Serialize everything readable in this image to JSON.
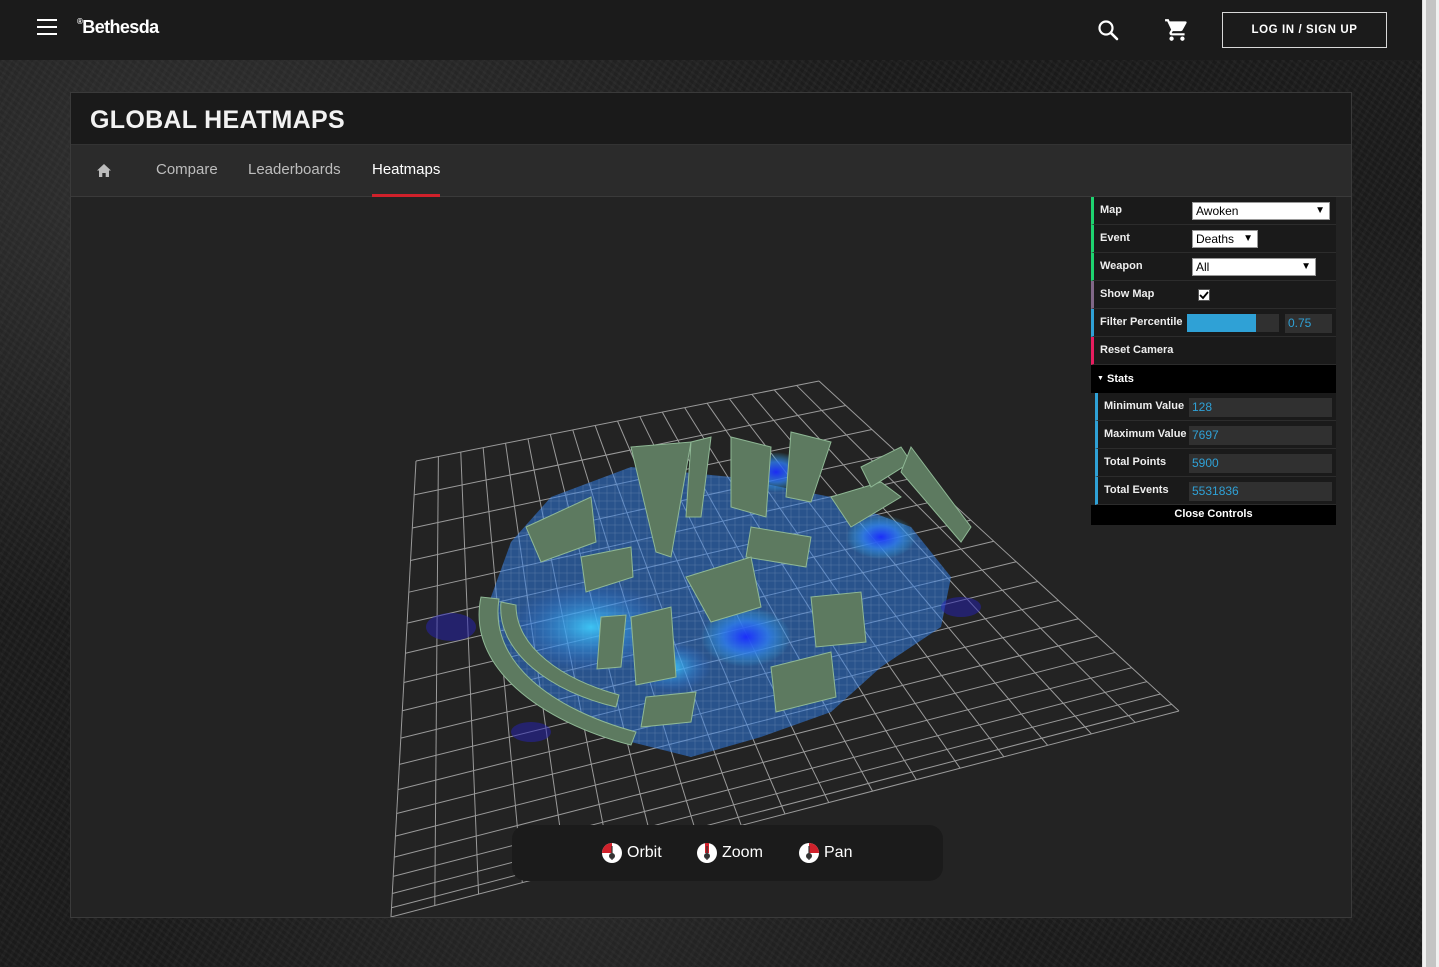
{
  "brand": {
    "logo_text": "Bethesda",
    "logo_mark": "®"
  },
  "header": {
    "login_label": "LOG IN / SIGN UP"
  },
  "page": {
    "title": "GLOBAL HEATMAPS"
  },
  "tabs": [
    {
      "label": "Compare"
    },
    {
      "label": "Leaderboards"
    },
    {
      "label": "Heatmaps",
      "active": true
    }
  ],
  "controls": {
    "map": {
      "label": "Map",
      "value": "Awoken"
    },
    "event": {
      "label": "Event",
      "value": "Deaths"
    },
    "weapon": {
      "label": "Weapon",
      "value": "All"
    },
    "show_map": {
      "label": "Show Map",
      "checked": true
    },
    "filter_percentile": {
      "label": "Filter Percentile",
      "value": "0.75",
      "fraction": 0.75
    },
    "reset_camera": {
      "label": "Reset Camera"
    },
    "stats": {
      "title": "Stats",
      "rows": [
        {
          "label": "Minimum Value",
          "value": "128"
        },
        {
          "label": "Maximum Value",
          "value": "7697"
        },
        {
          "label": "Total Points",
          "value": "5900"
        },
        {
          "label": "Total Events",
          "value": "5531836"
        }
      ]
    },
    "close_label": "Close Controls"
  },
  "nav_hints": [
    {
      "label": "Orbit"
    },
    {
      "label": "Zoom"
    },
    {
      "label": "Pan"
    }
  ],
  "colors": {
    "accent_red": "#d0212b",
    "controller_blue": "#2fa1d6",
    "controller_green": "#1ed36f",
    "controller_red": "#e61d5f"
  }
}
